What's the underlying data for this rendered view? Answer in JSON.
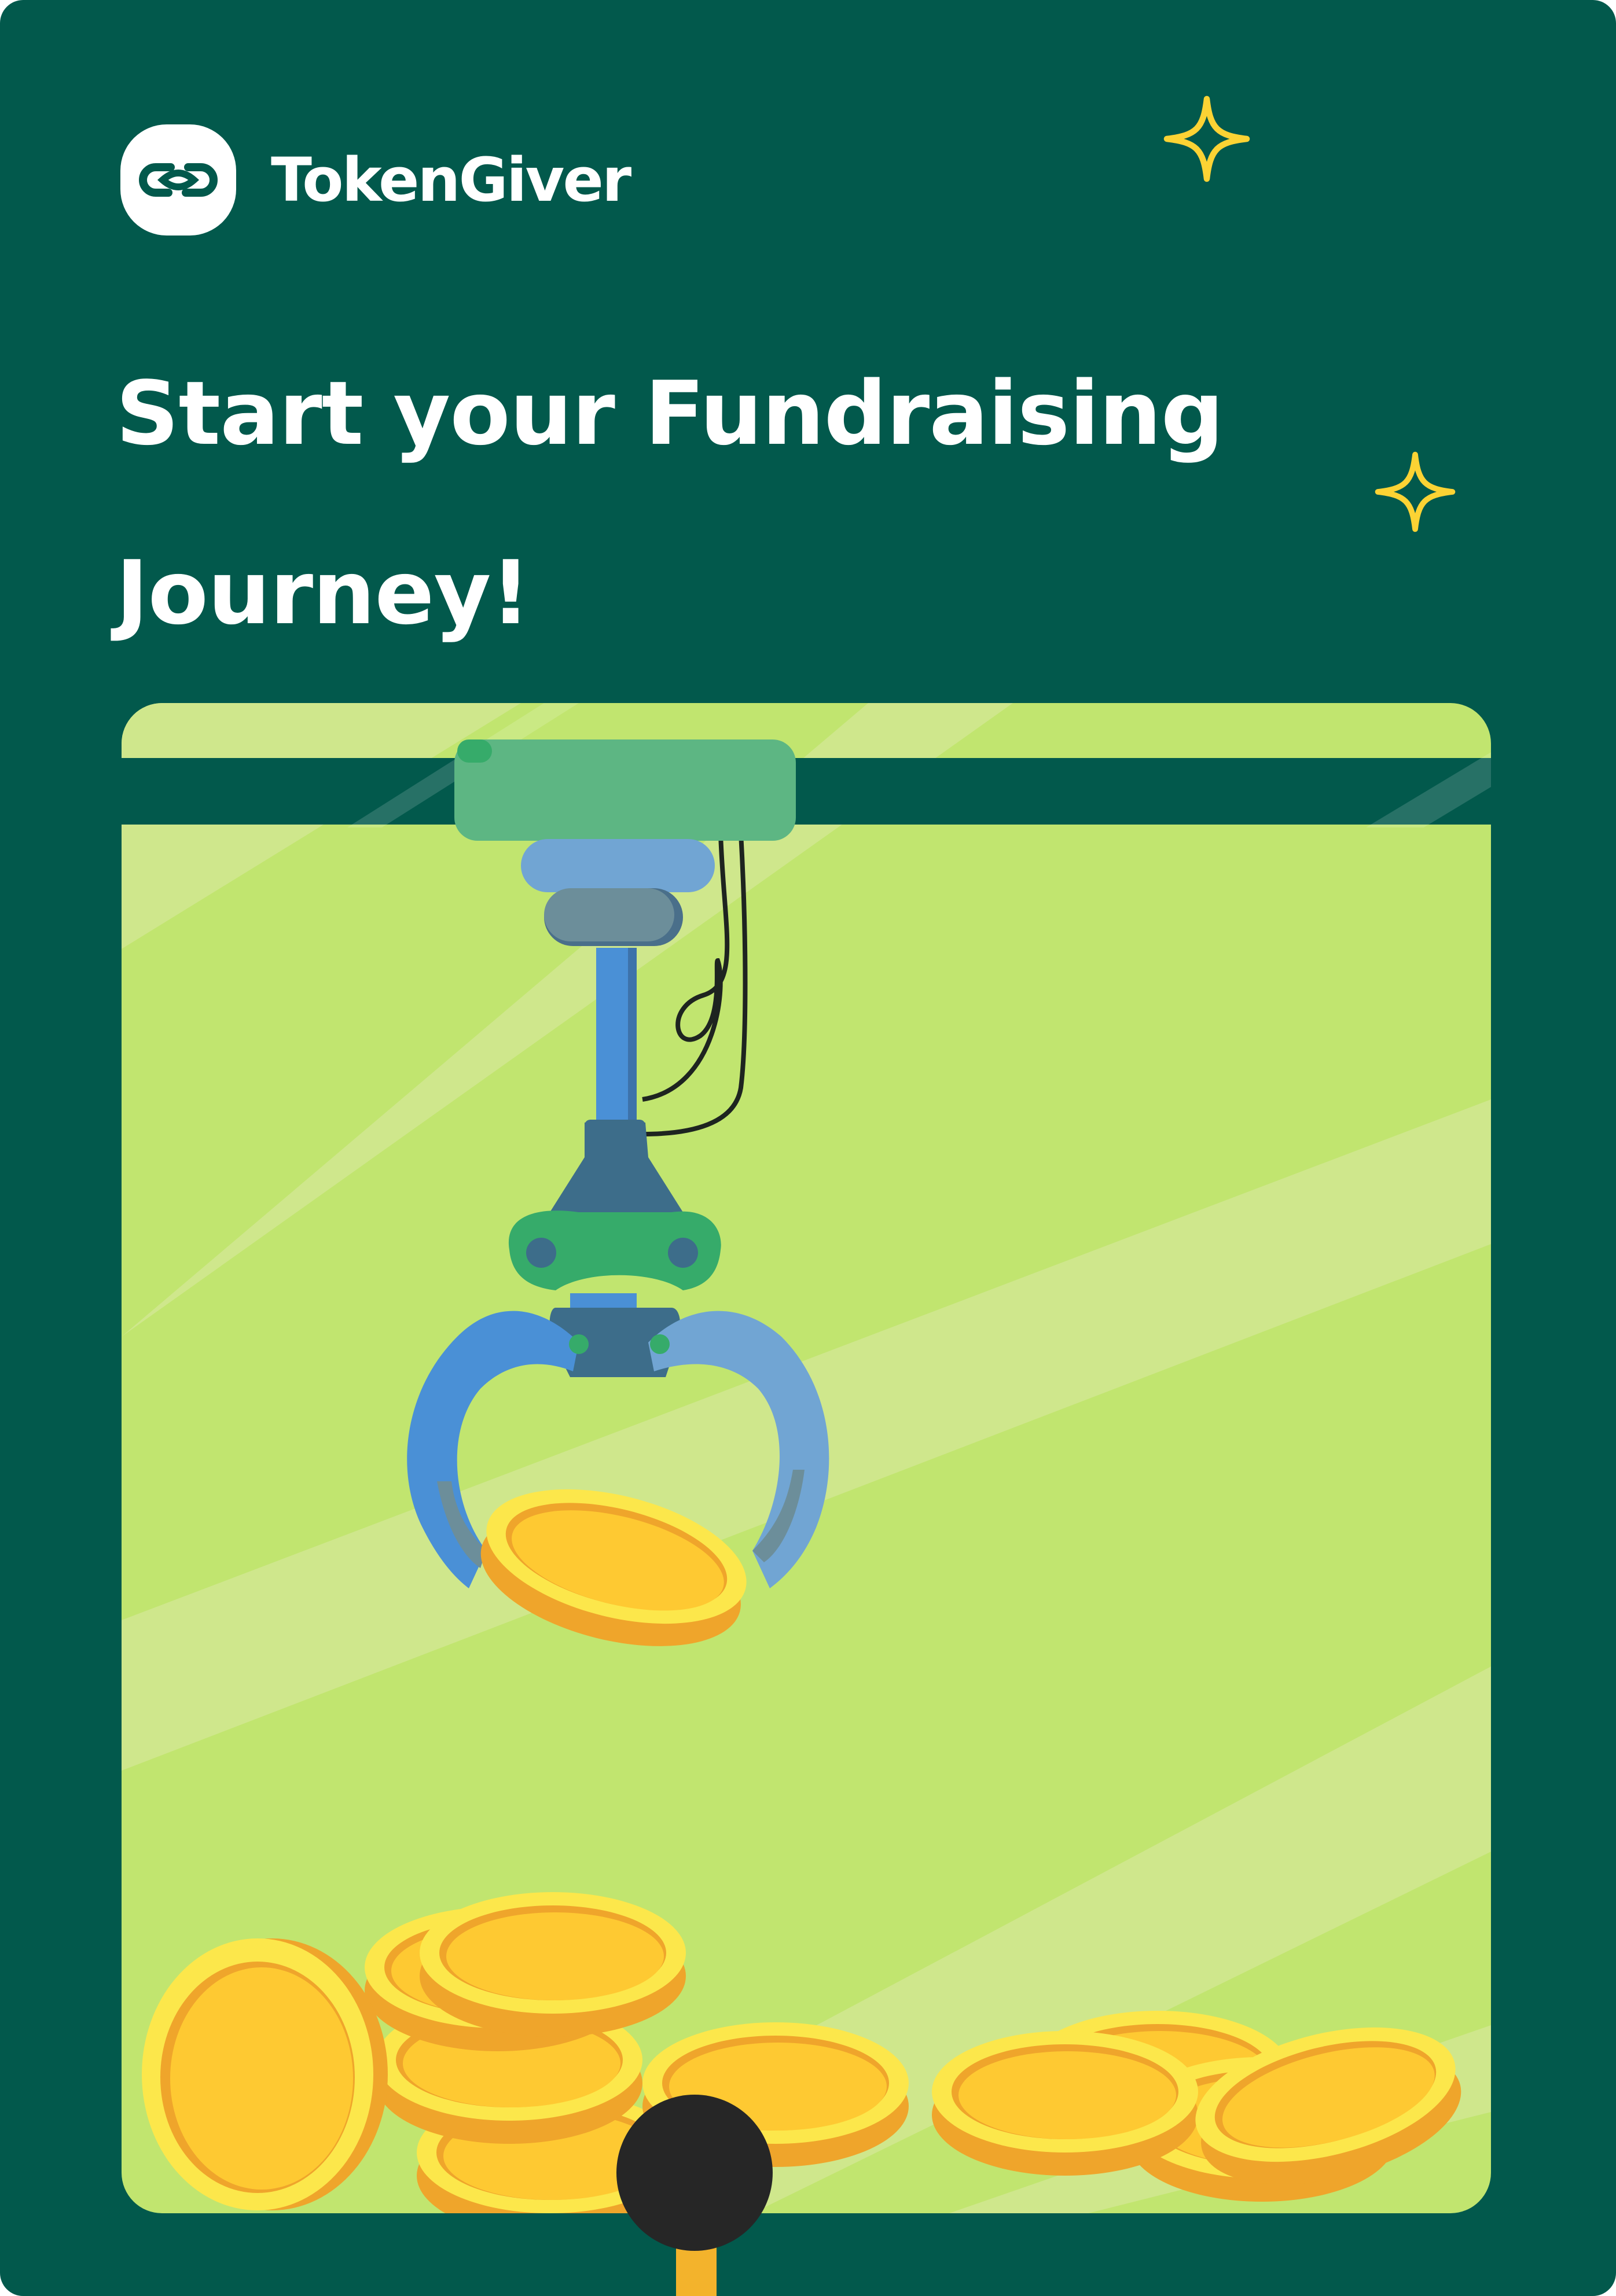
{
  "brand": {
    "name": "TokenGiver",
    "logo_icon": "chain-link-icon"
  },
  "headline": "Start your Fundraising Journey!",
  "decorations": {
    "sparkle_icon": "sparkle-icon",
    "illustration": "claw-machine-grabbing-coins"
  },
  "colors": {
    "background": "#02594c",
    "panel": "#c1e56f",
    "claw_green": "#36ab6a",
    "claw_blue": "#4a90d6",
    "coin": "#fec932",
    "coin_edge": "#efa52b",
    "sparkle": "#fcd334",
    "text": "#ffffff"
  }
}
